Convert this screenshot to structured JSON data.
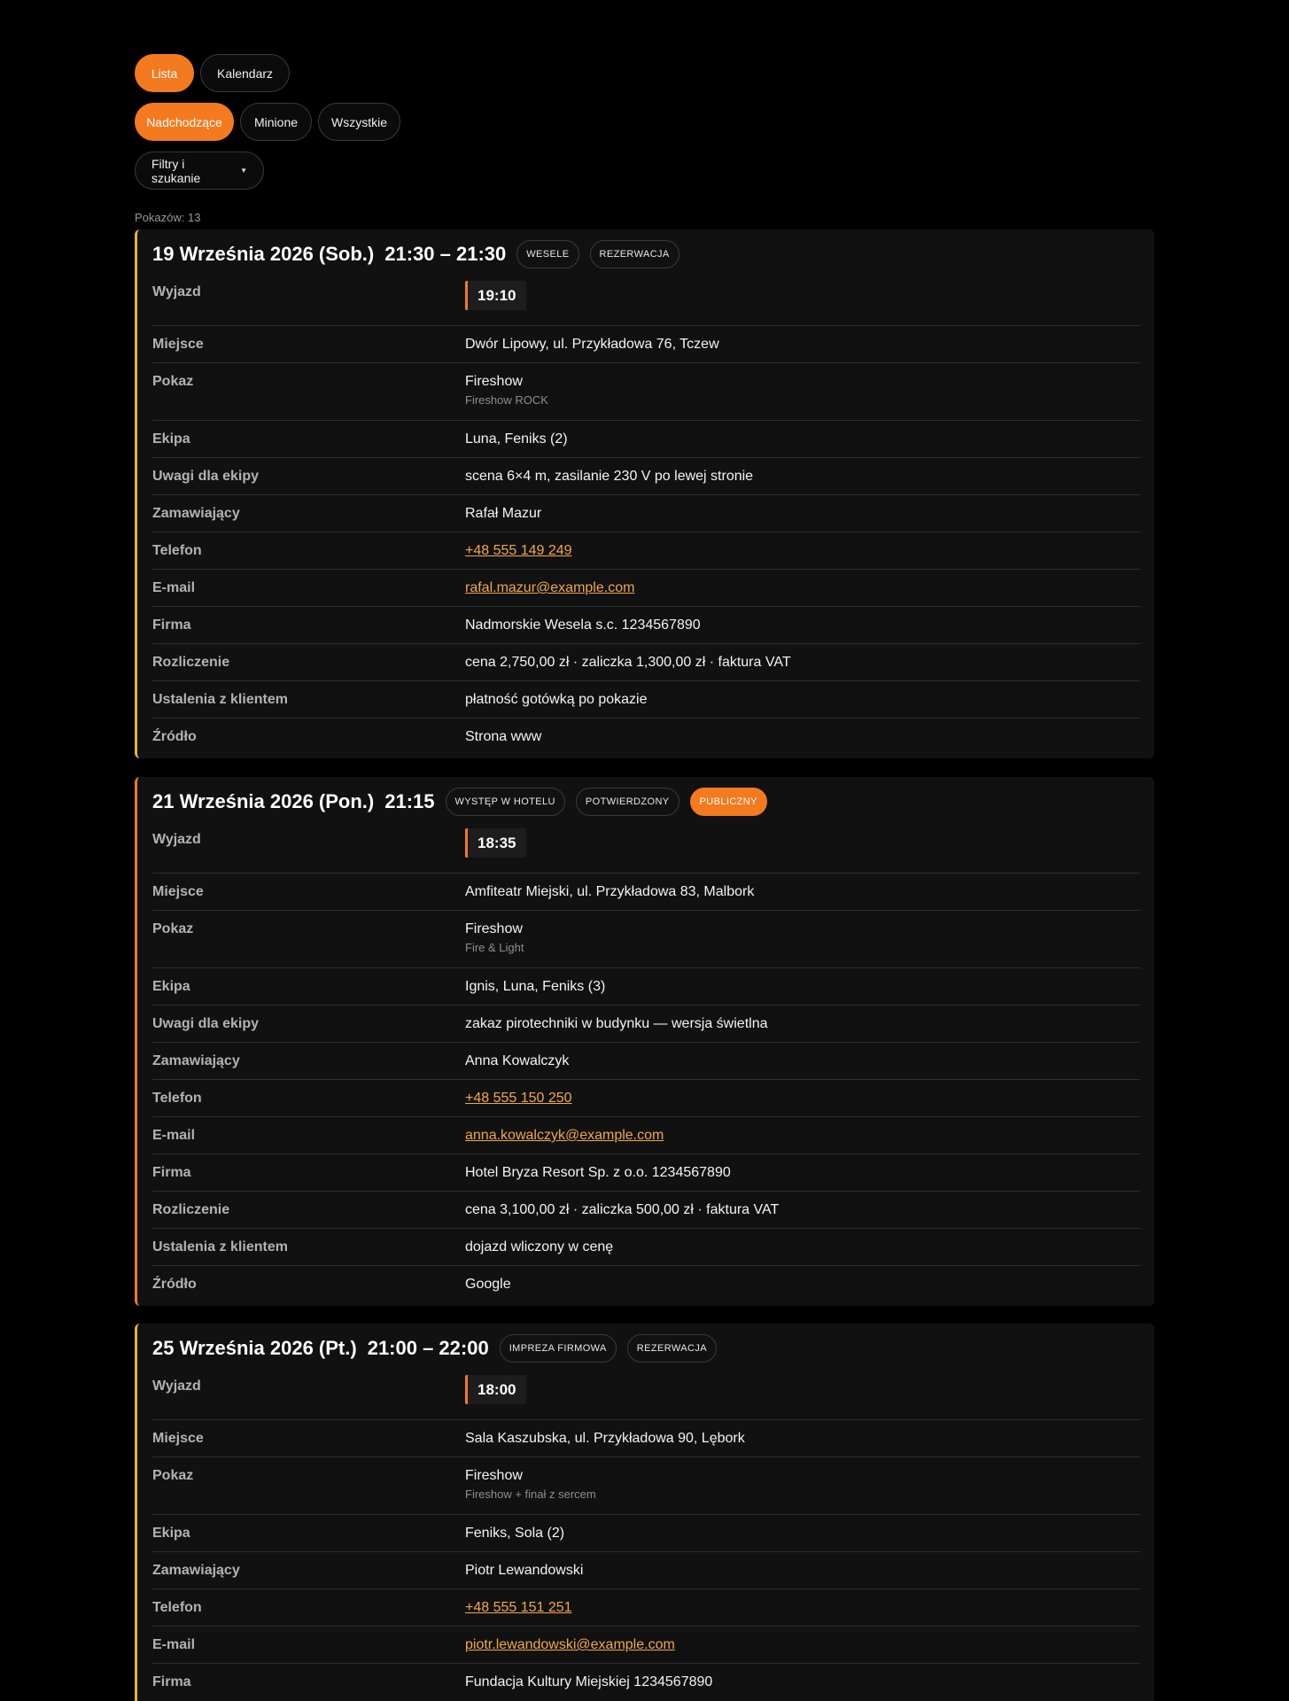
{
  "view_toggle": {
    "list_label": "Lista",
    "calendar_label": "Kalendarz"
  },
  "range_filter": {
    "upcoming_label": "Nadchodzące",
    "past_label": "Minione",
    "all_label": "Wszystkie"
  },
  "filters_button_label": "Filtry i szukanie",
  "count_text": "Pokazów: 13",
  "labels": {
    "departure": "Wyjazd",
    "place": "Miejsce",
    "show": "Pokaz",
    "crew": "Ekipa",
    "crew_notes": "Uwagi dla ekipy",
    "client": "Zamawiający",
    "phone": "Telefon",
    "email": "E-mail",
    "company": "Firma",
    "billing": "Rozliczenie",
    "client_terms": "Ustalenia z klientem",
    "source": "Źródło"
  },
  "events": [
    {
      "date": "19 Września 2026 (Sob.)",
      "time": "21:30 – 21:30",
      "tags": [
        "WESELE",
        "REZERWACJA"
      ],
      "departure": "19:10",
      "place": "Dwór Lipowy, ul. Przykładowa 76, Tczew",
      "show": "Fireshow",
      "show_variant": "Fireshow ROCK",
      "crew": "Luna, Feniks (2)",
      "crew_notes": "scena 6×4 m, zasilanie 230 V po lewej stronie",
      "client": "Rafał Mazur",
      "phone": "+48 555 149 249",
      "email": "rafal.mazur@example.com",
      "company": "Nadmorskie Wesela s.c. 1234567890",
      "billing": "cena 2,750,00 zł · zaliczka 1,300,00 zł · faktura VAT",
      "client_terms": "płatność gotówką po pokazie",
      "source": "Strona www"
    },
    {
      "date": "21 Września 2026 (Pon.)",
      "time": "21:15",
      "tags": [
        "WYSTĘP W HOTELU",
        "POTWIERDZONY",
        "PUBLICZNY"
      ],
      "departure": "18:35",
      "place": "Amfiteatr Miejski, ul. Przykładowa 83, Malbork",
      "show": "Fireshow",
      "show_variant": "Fire & Light",
      "crew": "Ignis, Luna, Feniks (3)",
      "crew_notes": "zakaz pirotechniki w budynku — wersja świetlna",
      "client": "Anna Kowalczyk",
      "phone": "+48 555 150 250",
      "email": "anna.kowalczyk@example.com",
      "company": "Hotel Bryza Resort Sp. z o.o. 1234567890",
      "billing": "cena 3,100,00 zł · zaliczka 500,00 zł · faktura VAT",
      "client_terms": "dojazd wliczony w cenę",
      "source": "Google"
    },
    {
      "date": "25 Września 2026 (Pt.)",
      "time": "21:00 – 22:00",
      "tags": [
        "IMPREZA FIRMOWA",
        "REZERWACJA"
      ],
      "departure": "18:00",
      "place": "Sala Kaszubska, ul. Przykładowa 90, Lębork",
      "show": "Fireshow",
      "show_variant": "Fireshow + finał z sercem",
      "crew": "Feniks, Sola (2)",
      "client": "Piotr Lewandowski",
      "phone": "+48 555 151 251",
      "email": "piotr.lewandowski@example.com",
      "company": "Fundacja Kultury Miejskiej 1234567890"
    }
  ],
  "colors": {
    "accent_orange": "#f47a1f",
    "accent_yellow": "#e8b23a",
    "link": "#f0a84b",
    "card_bg": "#111111",
    "page_bg": "#000000"
  }
}
